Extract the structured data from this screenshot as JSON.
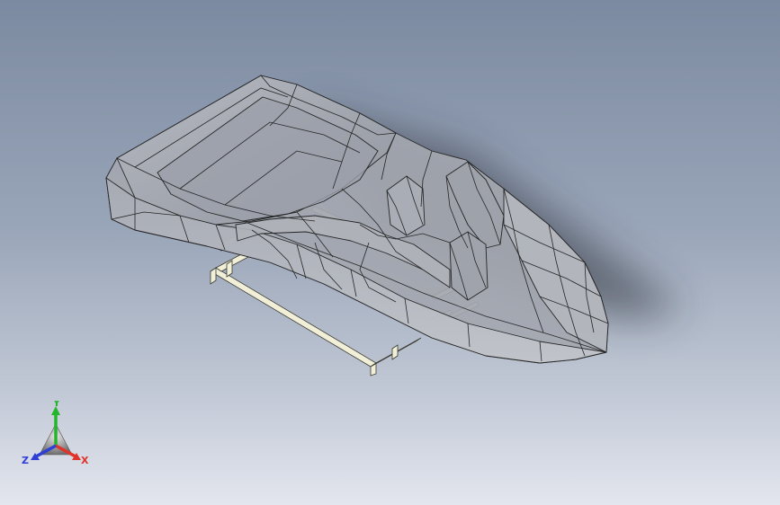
{
  "triad": {
    "x_label": "X",
    "y_label": "Y",
    "z_label": "Z",
    "x_color": "#e0342a",
    "y_color": "#23b52b",
    "z_color": "#2f3fd6"
  },
  "viewport": {
    "background_top": "#7c8aa1",
    "background_bottom": "#e3e6ee",
    "model_edge_color": "#2a2a2a",
    "frame_color": "#f1efd7"
  },
  "model": {
    "icon": "wireframe-boat-model"
  }
}
